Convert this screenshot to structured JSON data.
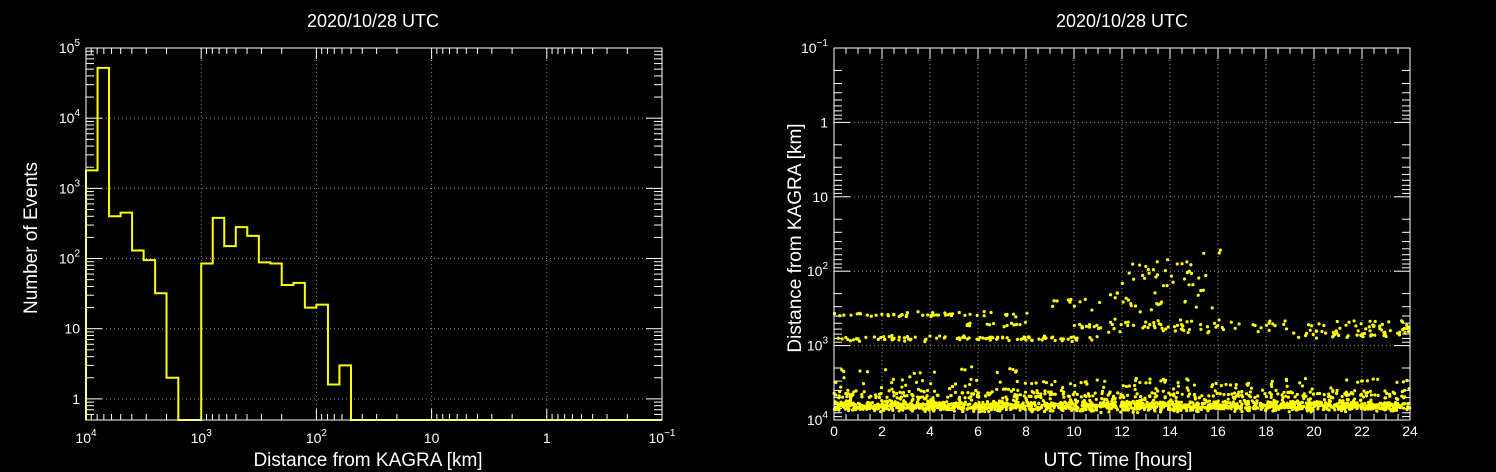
{
  "chart_data": [
    {
      "type": "bar",
      "title": "2020/10/28 UTC",
      "xlabel": "Distance from KAGRA [km]",
      "ylabel": "Number of Events",
      "x_scale": "log-reversed",
      "y_scale": "log",
      "xlim": [
        10000,
        0.1
      ],
      "ylim": [
        0.5,
        100000
      ],
      "grid": true,
      "x_ticks": [
        {
          "value": 10000,
          "base": "10",
          "exp": "4"
        },
        {
          "value": 1000,
          "base": "10",
          "exp": "3"
        },
        {
          "value": 100,
          "base": "10",
          "exp": "2"
        },
        {
          "value": 10,
          "base": "10",
          "exp": ""
        },
        {
          "value": 1,
          "base": "1",
          "exp": ""
        },
        {
          "value": 0.1,
          "base": "10",
          "exp": "−1"
        }
      ],
      "y_ticks": [
        {
          "value": 1,
          "base": "1",
          "exp": ""
        },
        {
          "value": 10,
          "base": "10",
          "exp": ""
        },
        {
          "value": 100,
          "base": "10",
          "exp": "2"
        },
        {
          "value": 1000,
          "base": "10",
          "exp": "3"
        },
        {
          "value": 10000,
          "base": "10",
          "exp": "4"
        },
        {
          "value": 100000,
          "base": "10",
          "exp": "5"
        }
      ],
      "bins": [
        {
          "x_from": 10000,
          "x_to": 7940,
          "count": 1800
        },
        {
          "x_from": 7940,
          "x_to": 6310,
          "count": 52000
        },
        {
          "x_from": 6310,
          "x_to": 5010,
          "count": 400
        },
        {
          "x_from": 5010,
          "x_to": 3980,
          "count": 450
        },
        {
          "x_from": 3980,
          "x_to": 3160,
          "count": 130
        },
        {
          "x_from": 3160,
          "x_to": 2510,
          "count": 95
        },
        {
          "x_from": 2510,
          "x_to": 2000,
          "count": 32
        },
        {
          "x_from": 2000,
          "x_to": 1580,
          "count": 2
        },
        {
          "x_from": 1580,
          "x_to": 1260,
          "count": 0
        },
        {
          "x_from": 1260,
          "x_to": 1000,
          "count": 0
        },
        {
          "x_from": 1000,
          "x_to": 794,
          "count": 85
        },
        {
          "x_from": 794,
          "x_to": 631,
          "count": 380
        },
        {
          "x_from": 631,
          "x_to": 501,
          "count": 150
        },
        {
          "x_from": 501,
          "x_to": 398,
          "count": 280
        },
        {
          "x_from": 398,
          "x_to": 316,
          "count": 210
        },
        {
          "x_from": 316,
          "x_to": 251,
          "count": 88
        },
        {
          "x_from": 251,
          "x_to": 200,
          "count": 85
        },
        {
          "x_from": 200,
          "x_to": 158,
          "count": 42
        },
        {
          "x_from": 158,
          "x_to": 126,
          "count": 45
        },
        {
          "x_from": 126,
          "x_to": 100,
          "count": 20
        },
        {
          "x_from": 100,
          "x_to": 79.4,
          "count": 22
        },
        {
          "x_from": 79.4,
          "x_to": 63.1,
          "count": 1.6
        },
        {
          "x_from": 63.1,
          "x_to": 50.1,
          "count": 3
        },
        {
          "x_from": 50.1,
          "x_to": 39.8,
          "count": 0
        }
      ],
      "color": "#ffff00"
    },
    {
      "type": "scatter",
      "title": "2020/10/28 UTC",
      "xlabel": "UTC Time [hours]",
      "ylabel": "Distance from KAGRA [km]",
      "y_scale": "log-reversed",
      "xlim": [
        0,
        24
      ],
      "ylim": [
        0.1,
        10000
      ],
      "grid": true,
      "x_ticks": [
        {
          "value": 0,
          "label": "0"
        },
        {
          "value": 2,
          "label": "2"
        },
        {
          "value": 4,
          "label": "4"
        },
        {
          "value": 6,
          "label": "6"
        },
        {
          "value": 8,
          "label": "8"
        },
        {
          "value": 10,
          "label": "10"
        },
        {
          "value": 12,
          "label": "12"
        },
        {
          "value": 14,
          "label": "14"
        },
        {
          "value": 16,
          "label": "16"
        },
        {
          "value": 18,
          "label": "18"
        },
        {
          "value": 20,
          "label": "20"
        },
        {
          "value": 22,
          "label": "22"
        },
        {
          "value": 24,
          "label": "24"
        }
      ],
      "y_ticks": [
        {
          "value": 0.1,
          "base": "10",
          "exp": "−1"
        },
        {
          "value": 1,
          "base": "1",
          "exp": ""
        },
        {
          "value": 10,
          "base": "10",
          "exp": ""
        },
        {
          "value": 100,
          "base": "10",
          "exp": "2"
        },
        {
          "value": 1000,
          "base": "10",
          "exp": "3"
        },
        {
          "value": 10000,
          "base": "10",
          "exp": "4"
        }
      ],
      "bands": [
        {
          "t_from": 0,
          "t_to": 24,
          "distance_center": 6500,
          "log_spread": 0.05,
          "density": 60
        },
        {
          "t_from": 0,
          "t_to": 24,
          "distance_center": 4700,
          "log_spread": 0.06,
          "density": 14
        },
        {
          "t_from": 0,
          "t_to": 24,
          "distance_center": 3200,
          "log_spread": 0.06,
          "density": 4
        },
        {
          "t_from": 0,
          "t_to": 8,
          "distance_center": 2200,
          "log_spread": 0.04,
          "density": 2
        },
        {
          "t_from": 0,
          "t_to": 11,
          "distance_center": 800,
          "log_spread": 0.025,
          "density": 9
        },
        {
          "t_from": 0,
          "t_to": 8.2,
          "distance_center": 380,
          "log_spread": 0.03,
          "density": 6
        },
        {
          "t_from": 5.5,
          "t_to": 8,
          "distance_center": 520,
          "log_spread": 0.03,
          "density": 6
        },
        {
          "t_from": 10,
          "t_to": 24,
          "distance_center": 550,
          "log_spread": 0.06,
          "density": 8
        },
        {
          "t_from": 9,
          "t_to": 16,
          "distance_center": 250,
          "log_spread": 0.12,
          "density": 5
        },
        {
          "t_from": 12,
          "t_to": 15.5,
          "distance_center": 110,
          "log_spread": 0.2,
          "density": 9
        },
        {
          "t_from": 19,
          "t_to": 24,
          "distance_center": 700,
          "log_spread": 0.05,
          "density": 8
        }
      ],
      "points": [
        {
          "t": 16.1,
          "distance": 52
        },
        {
          "t": 16.05,
          "distance": 57
        },
        {
          "t": 13.9,
          "distance": 70
        },
        {
          "t": 14.3,
          "distance": 80
        }
      ],
      "color": "#ffff00"
    }
  ]
}
